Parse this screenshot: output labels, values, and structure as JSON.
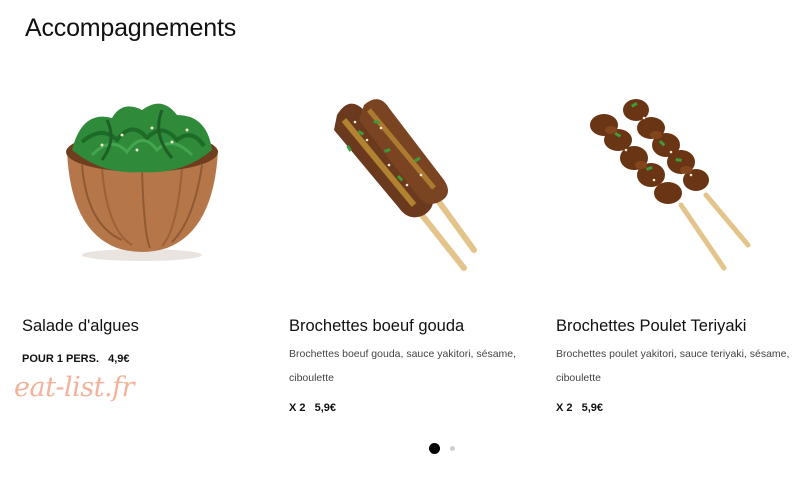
{
  "section": {
    "title": "Accompagnements"
  },
  "products": [
    {
      "name": "Salade d'algues",
      "description": "",
      "quantity": "POUR 1 PERS.",
      "price": "4,9€",
      "image_icon": "seaweed-salad-bowl"
    },
    {
      "name": "Brochettes boeuf gouda",
      "description": "Brochettes boeuf gouda, sauce yakitori, sésame, ciboulette",
      "quantity": "X 2",
      "price": "5,9€",
      "image_icon": "beef-skewer"
    },
    {
      "name": "Brochettes Poulet Teriyaki",
      "description": "Brochettes poulet yakitori, sauce teriyaki, sésame, ciboulette",
      "quantity": "X 2",
      "price": "5,9€",
      "image_icon": "chicken-skewer"
    }
  ],
  "watermark": "eat-list.fr",
  "carousel": {
    "active_page": 1,
    "page_count": 2
  },
  "colors": {
    "watermark": "#f2b39a",
    "text": "#111111",
    "muted": "#444444",
    "dot_active": "#000000",
    "dot_inactive": "#cfcfcf"
  }
}
